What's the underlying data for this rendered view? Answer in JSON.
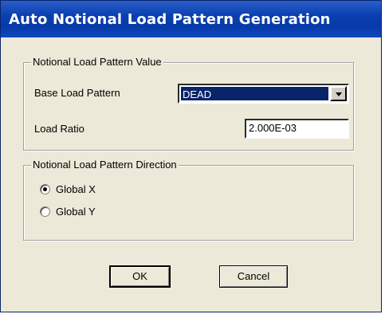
{
  "window": {
    "title": "Auto Notional Load Pattern Generation"
  },
  "value_group": {
    "legend": "Notional Load Pattern Value",
    "base_label": "Base Load Pattern",
    "base_value": "DEAD",
    "ratio_label": "Load Ratio",
    "ratio_value": "2.000E-03"
  },
  "direction_group": {
    "legend": "Notional Load Pattern Direction",
    "options": [
      {
        "label": "Global X",
        "selected": true
      },
      {
        "label": "Global Y",
        "selected": false
      }
    ]
  },
  "buttons": {
    "ok": "OK",
    "cancel": "Cancel"
  },
  "colors": {
    "title_bar": "#0a3fb0",
    "dialog_bg": "#ece9d8",
    "selection": "#0a246a"
  }
}
